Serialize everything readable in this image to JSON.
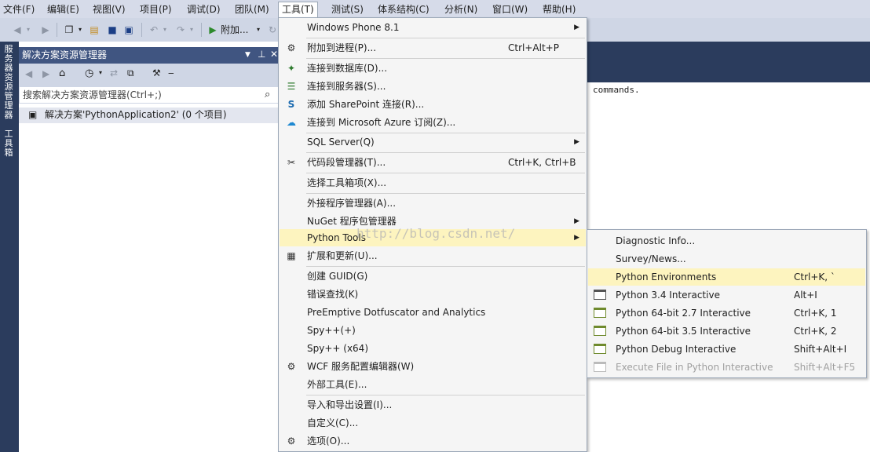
{
  "menubar": {
    "items": [
      {
        "label": "文件(F)"
      },
      {
        "label": "编辑(E)"
      },
      {
        "label": "视图(V)"
      },
      {
        "label": "项目(P)"
      },
      {
        "label": "调试(D)"
      },
      {
        "label": "团队(M)"
      },
      {
        "label": "工具(T)"
      },
      {
        "label": "测试(S)"
      },
      {
        "label": "体系结构(C)"
      },
      {
        "label": "分析(N)"
      },
      {
        "label": "窗口(W)"
      },
      {
        "label": "帮助(H)"
      }
    ]
  },
  "toolbar": {
    "attach_label": "附加..."
  },
  "left_strip": {
    "server_explorer": "服务器资源管理器",
    "toolbox": "工具箱"
  },
  "solution_explorer": {
    "title": "解决方案资源管理器",
    "search_placeholder": "搜索解决方案资源管理器(Ctrl+;)",
    "solution_node": "解决方案'PythonApplication2' (0 个项目)"
  },
  "document": {
    "visible_text": "commands."
  },
  "tools_menu": {
    "items": [
      {
        "label": "Windows Phone 8.1",
        "shortcut": "",
        "submenu": true,
        "icon": ""
      },
      {
        "label": "附加到进程(P)...",
        "shortcut": "Ctrl+Alt+P",
        "submenu": false,
        "icon": "gear-attach-icon"
      },
      {
        "label": "连接到数据库(D)...",
        "shortcut": "",
        "submenu": false,
        "icon": "database-connect-icon"
      },
      {
        "label": "连接到服务器(S)...",
        "shortcut": "",
        "submenu": false,
        "icon": "server-connect-icon"
      },
      {
        "label": "添加 SharePoint 连接(R)...",
        "shortcut": "",
        "submenu": false,
        "icon": "sharepoint-icon"
      },
      {
        "label": "连接到 Microsoft Azure 订阅(Z)...",
        "shortcut": "",
        "submenu": false,
        "icon": "azure-cloud-icon"
      },
      {
        "label": "SQL Server(Q)",
        "shortcut": "",
        "submenu": true,
        "icon": ""
      },
      {
        "label": "代码段管理器(T)...",
        "shortcut": "Ctrl+K, Ctrl+B",
        "submenu": false,
        "icon": "snippet-icon"
      },
      {
        "label": "选择工具箱项(X)...",
        "shortcut": "",
        "submenu": false,
        "icon": ""
      },
      {
        "label": "外接程序管理器(A)...",
        "shortcut": "",
        "submenu": false,
        "icon": ""
      },
      {
        "label": "NuGet 程序包管理器",
        "shortcut": "",
        "submenu": true,
        "icon": ""
      },
      {
        "label": "Python Tools",
        "shortcut": "",
        "submenu": true,
        "icon": ""
      },
      {
        "label": "扩展和更新(U)...",
        "shortcut": "",
        "submenu": false,
        "icon": "extensions-icon"
      },
      {
        "label": "创建 GUID(G)",
        "shortcut": "",
        "submenu": false,
        "icon": ""
      },
      {
        "label": "错误查找(K)",
        "shortcut": "",
        "submenu": false,
        "icon": ""
      },
      {
        "label": "PreEmptive Dotfuscator and Analytics",
        "shortcut": "",
        "submenu": false,
        "icon": ""
      },
      {
        "label": "Spy++(+)",
        "shortcut": "",
        "submenu": false,
        "icon": ""
      },
      {
        "label": "Spy++ (x64)",
        "shortcut": "",
        "submenu": false,
        "icon": ""
      },
      {
        "label": "WCF 服务配置编辑器(W)",
        "shortcut": "",
        "submenu": false,
        "icon": "wcf-gear-icon"
      },
      {
        "label": "外部工具(E)...",
        "shortcut": "",
        "submenu": false,
        "icon": ""
      },
      {
        "label": "导入和导出设置(I)...",
        "shortcut": "",
        "submenu": false,
        "icon": ""
      },
      {
        "label": "自定义(C)...",
        "shortcut": "",
        "submenu": false,
        "icon": ""
      },
      {
        "label": "选项(O)...",
        "shortcut": "",
        "submenu": false,
        "icon": "options-gear-icon"
      }
    ]
  },
  "python_tools_submenu": {
    "items": [
      {
        "label": "Diagnostic Info...",
        "shortcut": "",
        "icon": "",
        "disabled": false
      },
      {
        "label": "Survey/News...",
        "shortcut": "",
        "icon": "",
        "disabled": false
      },
      {
        "label": "Python Environments",
        "shortcut": "Ctrl+K, `",
        "icon": "",
        "disabled": false
      },
      {
        "label": "Python 3.4 Interactive",
        "shortcut": "Alt+I",
        "icon": "window-icon",
        "disabled": false
      },
      {
        "label": "Python 64-bit 2.7 Interactive",
        "shortcut": "Ctrl+K, 1",
        "icon": "window-icon",
        "disabled": false
      },
      {
        "label": "Python 64-bit 3.5 Interactive",
        "shortcut": "Ctrl+K, 2",
        "icon": "window-icon",
        "disabled": false
      },
      {
        "label": "Python Debug Interactive",
        "shortcut": "Shift+Alt+I",
        "icon": "window-icon",
        "disabled": false
      },
      {
        "label": "Execute File in Python Interactive",
        "shortcut": "Shift+Alt+F5",
        "icon": "window-icon",
        "disabled": true
      }
    ]
  },
  "watermark": "http://blog.csdn.net/",
  "colors": {
    "menubar_bg": "#d6dbe9",
    "toolbar_bg": "#cfd6e5",
    "panel_title": "#405581",
    "dark_bg": "#2b3c5d",
    "highlight": "#fdf4bf",
    "menu_bg": "#f5f5f5"
  }
}
